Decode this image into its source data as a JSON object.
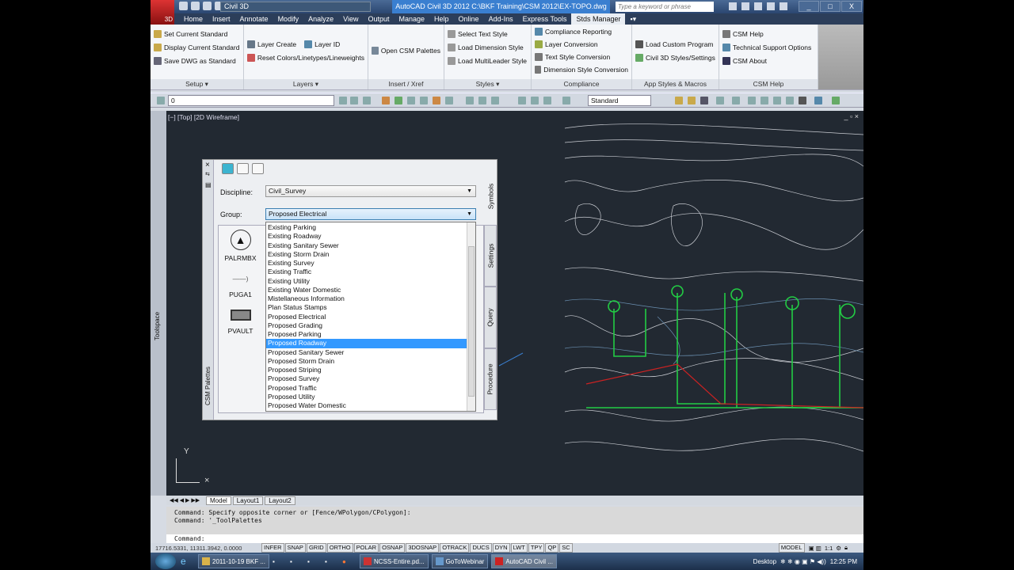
{
  "title_bar": {
    "app_badge": "3D",
    "workspace": "Civil 3D",
    "title": "AutoCAD Civil 3D 2012   C:\\BKF Training\\CSM 2012\\EX-TOPO.dwg",
    "search_placeholder": "Type a keyword or phrase",
    "window_controls": [
      "_",
      "□",
      "X"
    ]
  },
  "ribbon_tabs": [
    "Home",
    "Insert",
    "Annotate",
    "Modify",
    "Analyze",
    "View",
    "Output",
    "Manage",
    "Help",
    "Online",
    "Add-Ins",
    "Express Tools",
    "Stds Manager"
  ],
  "active_tab": "Stds Manager",
  "ribbon_panels": [
    {
      "label": "Setup ▾",
      "items": [
        "Set Current Standard",
        "Display Current Standard",
        "Save DWG as Standard"
      ]
    },
    {
      "label": "Layers ▾",
      "items": [
        "Layer Create",
        "Layer ID",
        "Reset Colors/Linetypes/Lineweights"
      ]
    },
    {
      "label": "Insert / Xref",
      "items": [
        "Open CSM Palettes"
      ]
    },
    {
      "label": "Styles ▾",
      "items": [
        "Select Text Style",
        "Load Dimension Style",
        "Load MultiLeader Style"
      ]
    },
    {
      "label": "Compliance",
      "items": [
        "Compliance Reporting",
        "Layer Conversion",
        "Text Style Conversion",
        "Dimension Style Conversion"
      ]
    },
    {
      "label": "App Styles & Macros",
      "items": [
        "Load Custom Program",
        "Civil 3D Styles/Settings"
      ]
    },
    {
      "label": "CSM Help",
      "items": [
        "CSM Help",
        "Technical Support Options",
        "CSM About"
      ]
    }
  ],
  "toolbar": {
    "layer_value": "0",
    "style_value": "Standard"
  },
  "viewport": {
    "label": "[−] [Top] [2D Wireframe]",
    "controls": "_ ▫ ×",
    "ucs_y": "Y"
  },
  "palette": {
    "title": "CSM Palettes",
    "discipline_label": "Discipline:",
    "discipline_value": "Civil_Survey",
    "group_label": "Group:",
    "group_value": "Proposed Electrical",
    "side_tabs": [
      "Symbols",
      "Settings",
      "Query",
      "Procedure"
    ],
    "symbols": [
      "PALRMBX",
      "PUGA1",
      "PVAULT"
    ],
    "group_options": [
      "Existing Parking",
      "Existing Roadway",
      "Existing Sanitary Sewer",
      "Existing Storm Drain",
      "Existing Survey",
      "Existing Traffic",
      "Existing Utility",
      "Existing Water Domestic",
      "Mistellaneous Information",
      "Plan Status Stamps",
      "Proposed Electrical",
      "Proposed Grading",
      "Proposed Parking",
      "Proposed Roadway",
      "Proposed Sanitary Sewer",
      "Proposed Storm Drain",
      "Proposed Striping",
      "Proposed Survey",
      "Proposed Traffic",
      "Proposed Utility",
      "Proposed Water Domestic"
    ],
    "highlighted_option": "Proposed Roadway"
  },
  "side_label": "Toolspace",
  "layout_tabs": [
    "Model",
    "Layout1",
    "Layout2"
  ],
  "command": {
    "history": [
      "Command: Specify opposite corner or [Fence/WPolygon/CPolygon]:",
      "Command: '_ToolPalettes"
    ],
    "prompt": "Command:"
  },
  "status_bar": {
    "coords": "17716.5331, 11311.3942, 0.0000",
    "toggles": [
      "INFER",
      "SNAP",
      "GRID",
      "ORTHO",
      "POLAR",
      "OSNAP",
      "3DOSNAP",
      "OTRACK",
      "DUCS",
      "DYN",
      "LWT",
      "TPY",
      "QP",
      "SC"
    ],
    "model": "MODEL",
    "scale": "1:1"
  },
  "taskbar": {
    "tasks": [
      "2011-10-19 BKF ...",
      "NCSS-Entire.pd...",
      "GoToWebinar",
      "AutoCAD Civil ..."
    ],
    "desktop": "Desktop",
    "clock": "12:25 PM"
  }
}
